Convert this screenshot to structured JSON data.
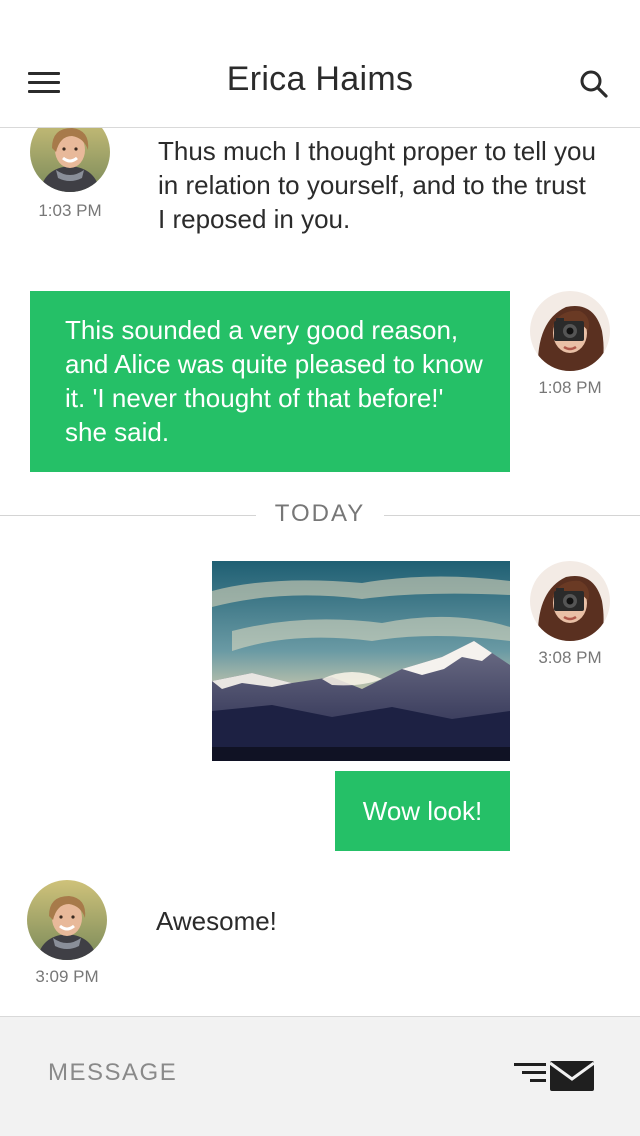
{
  "header": {
    "title": "Erica Haims"
  },
  "messages": [
    {
      "sender": "incoming",
      "text": "Thus much I thought proper to tell you in relation to yourself, and to the trust I reposed in you.",
      "time": "1:03 PM"
    },
    {
      "sender": "outgoing",
      "text": "This sounded a very good reason, and Alice was quite pleased to know it. 'I never thought of that before!' she said.",
      "time": "1:08 PM"
    },
    {
      "sender": "outgoing",
      "image": "mountain-landscape",
      "text": "Wow look!",
      "time": "3:08 PM"
    },
    {
      "sender": "incoming",
      "text": "Awesome!",
      "time": "3:09 PM"
    }
  ],
  "divider": {
    "label": "TODAY"
  },
  "composer": {
    "placeholder": "MESSAGE"
  },
  "colors": {
    "accent": "#25c067",
    "background": "#ffffff",
    "composer_bg": "#f2f2f2",
    "text": "#2b2b2b",
    "muted": "#777777"
  },
  "icons": [
    "hamburger-menu-icon",
    "search-icon",
    "send-message-icon"
  ]
}
